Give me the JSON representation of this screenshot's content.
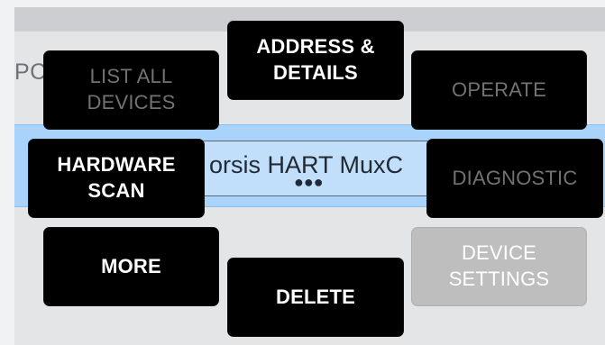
{
  "background": {
    "partial_label": "PC"
  },
  "selected_device": {
    "name": "orsis HART MuxC",
    "menu_indicator": "●●●"
  },
  "menu": {
    "address_details": "ADDRESS &\nDETAILS",
    "list_all_devices": "LIST ALL\nDEVICES",
    "operate": "OPERATE",
    "hardware_scan": "HARDWARE\nSCAN",
    "diagnostic": "DIAGNOSTIC",
    "more": "MORE",
    "device_settings": "DEVICE\nSETTINGS",
    "delete": "DELETE"
  },
  "colors": {
    "selected_row": "#a9d3fb",
    "enabled_button": "#000000",
    "disabled_text": "#727272",
    "light_button": "#bebebe"
  }
}
